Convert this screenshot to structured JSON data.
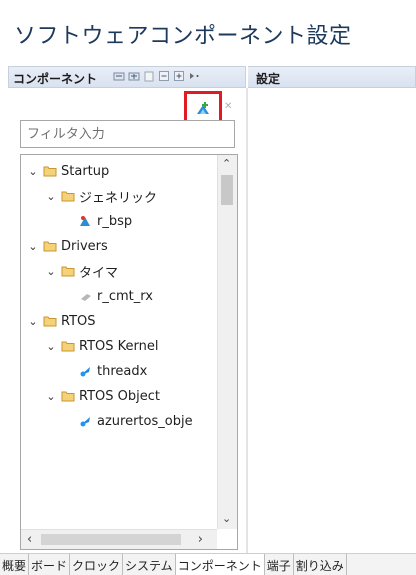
{
  "window": {
    "title": "ソフトウェアコンポーネント設定"
  },
  "left_panel": {
    "header_label": "コンポーネント",
    "toolbar_icons": [
      "collapse-all-icon",
      "expand-all-icon",
      "show-hide-icon",
      "remove-icon",
      "add-icon",
      "menu-icon"
    ],
    "add_component_icon": "add-component-icon",
    "filter_placeholder": "フィルタ入力",
    "tree": [
      {
        "label": "Startup",
        "level": 0,
        "expanded": true,
        "icon": "folder-icon"
      },
      {
        "label": "ジェネリック",
        "level": 1,
        "expanded": true,
        "icon": "folder-icon"
      },
      {
        "label": "r_bsp",
        "level": 2,
        "icon": "component-icon"
      },
      {
        "label": "Drivers",
        "level": 0,
        "expanded": true,
        "icon": "folder-icon"
      },
      {
        "label": "タイマ",
        "level": 1,
        "expanded": true,
        "icon": "folder-icon"
      },
      {
        "label": "r_cmt_rx",
        "level": 2,
        "icon": "driver-icon"
      },
      {
        "label": "RTOS",
        "level": 0,
        "expanded": true,
        "icon": "folder-icon"
      },
      {
        "label": "RTOS Kernel",
        "level": 1,
        "expanded": true,
        "icon": "folder-icon"
      },
      {
        "label": "threadx",
        "level": 2,
        "icon": "rtos-icon"
      },
      {
        "label": "RTOS Object",
        "level": 1,
        "expanded": true,
        "icon": "folder-icon"
      },
      {
        "label": "azurertos_obje",
        "level": 2,
        "icon": "rtos-icon"
      }
    ]
  },
  "right_panel": {
    "header_label": "設定"
  },
  "bottom_tabs": [
    "概要",
    "ボード",
    "クロック",
    "システム",
    "コンポーネント",
    "端子",
    "割り込み"
  ],
  "active_tab": "コンポーネント",
  "colors": {
    "highlight_box": "#e01b24",
    "title": "#1d3a5c",
    "folder": "#e8b34a"
  }
}
